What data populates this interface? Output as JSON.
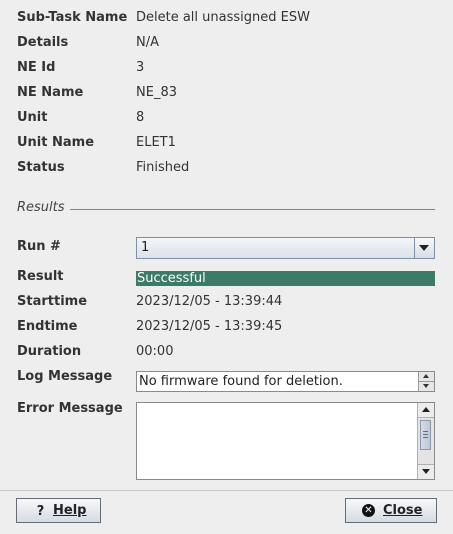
{
  "details": {
    "sub_task_name_label": "Sub-Task Name",
    "sub_task_name": "Delete all unassigned ESW",
    "details_label": "Details",
    "details": "N/A",
    "ne_id_label": "NE Id",
    "ne_id": "3",
    "ne_name_label": "NE Name",
    "ne_name": "NE_83",
    "unit_label": "Unit",
    "unit": "8",
    "unit_name_label": "Unit Name",
    "unit_name": "ELET1",
    "status_label": "Status",
    "status": "Finished"
  },
  "results": {
    "section_title": "Results",
    "run_label": "Run #",
    "run_selected": "1",
    "result_label": "Result",
    "result": "Successful",
    "result_color": "#3d7b69",
    "starttime_label": "Starttime",
    "starttime": "2023/12/05 - 13:39:44",
    "endtime_label": "Endtime",
    "endtime": "2023/12/05 - 13:39:45",
    "duration_label": "Duration",
    "duration": "00:00",
    "log_label": "Log Message",
    "log_message": "No firmware found for deletion.",
    "error_label": "Error Message",
    "error_message": ""
  },
  "buttons": {
    "help": "Help",
    "close": "Close",
    "help_icon": "question-icon",
    "close_icon": "close-circle-icon"
  }
}
